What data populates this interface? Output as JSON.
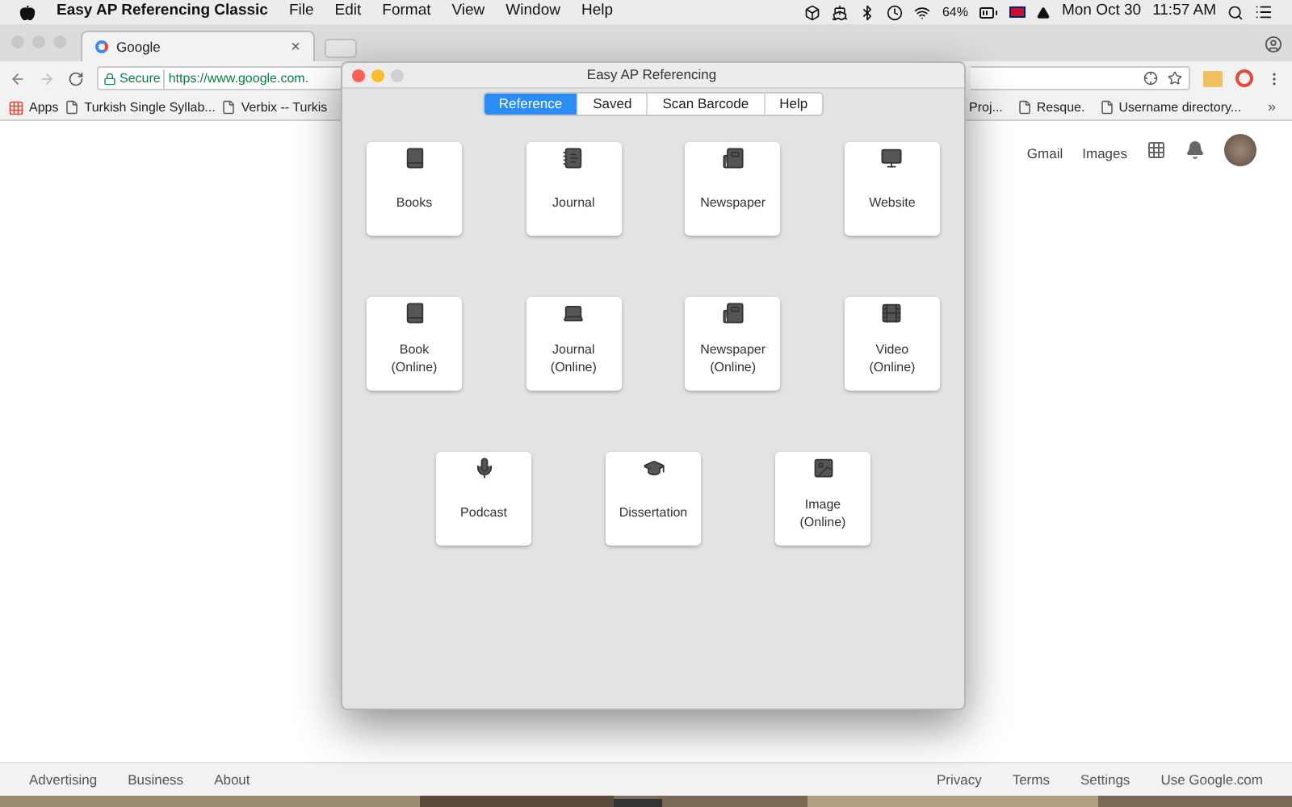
{
  "menu_bar": {
    "app_name": "Easy AP Referencing Classic",
    "menus": [
      "File",
      "Edit",
      "Format",
      "View",
      "Window",
      "Help"
    ],
    "battery": "64%",
    "date": "Mon Oct 30",
    "time": "11:57 AM"
  },
  "browser": {
    "tab_title": "Google",
    "tab_close": "×",
    "secure_label": "Secure",
    "url": "https://www.google.com.",
    "bookmarks_left": [
      {
        "kind": "apps",
        "label": "Apps"
      },
      {
        "kind": "page",
        "label": "Turkish Single Syllab..."
      },
      {
        "kind": "page",
        "label": "Verbix -- Turkis"
      }
    ],
    "bookmarks_right": [
      {
        "kind": "plain",
        "label": "Proj..."
      },
      {
        "kind": "page",
        "label": "Resque."
      },
      {
        "kind": "page",
        "label": "Username directory..."
      }
    ],
    "bookmarks_overflow": "»",
    "header_links": [
      "Gmail",
      "Images"
    ],
    "footer_left": [
      "Advertising",
      "Business",
      "About"
    ],
    "footer_right": [
      "Privacy",
      "Terms",
      "Settings",
      "Use Google.com"
    ]
  },
  "app_window": {
    "title": "Easy AP Referencing",
    "tabs": [
      {
        "label": "Reference",
        "selected": true
      },
      {
        "label": "Saved",
        "selected": false
      },
      {
        "label": "Scan Barcode",
        "selected": false
      },
      {
        "label": "Help",
        "selected": false
      }
    ],
    "card_rows": [
      [
        {
          "kind": "book",
          "label": "Books"
        },
        {
          "kind": "journal",
          "label": "Journal"
        },
        {
          "kind": "newspaper",
          "label": "Newspaper"
        },
        {
          "kind": "website",
          "label": "Website"
        }
      ],
      [
        {
          "kind": "book",
          "label": "Book\n(Online)"
        },
        {
          "kind": "laptop",
          "label": "Journal\n(Online)"
        },
        {
          "kind": "newspaper",
          "label": "Newspaper\n(Online)"
        },
        {
          "kind": "video",
          "label": "Video\n(Online)"
        }
      ],
      [
        {
          "kind": "podcast",
          "label": "Podcast"
        },
        {
          "kind": "dissertation",
          "label": "Dissertation"
        },
        {
          "label": "Image\n(Online)"
        }
      ]
    ]
  }
}
